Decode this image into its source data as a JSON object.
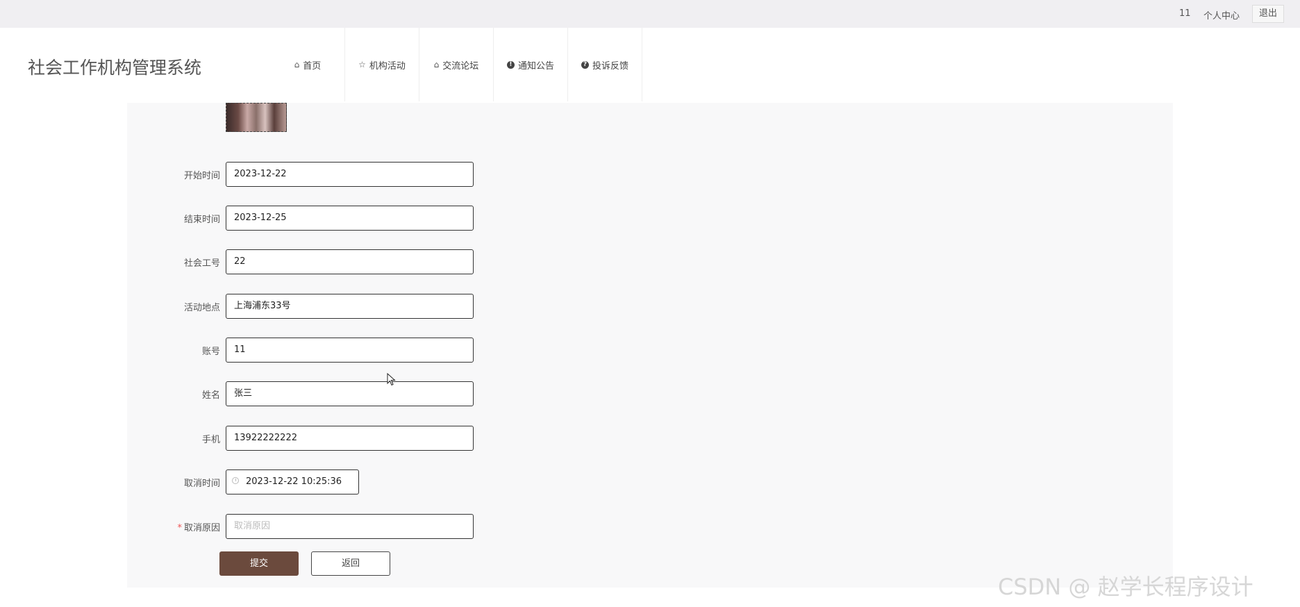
{
  "topbar": {
    "username": "11",
    "profile_label": "个人中心",
    "logout_label": "退出"
  },
  "header": {
    "brand": "社会工作机构管理系统",
    "nav": [
      {
        "label": "首页",
        "icon": "home-icon"
      },
      {
        "label": "机构活动",
        "icon": "star-icon"
      },
      {
        "label": "交流论坛",
        "icon": "bag-icon"
      },
      {
        "label": "通知公告",
        "icon": "alert-icon"
      },
      {
        "label": "投诉反馈",
        "icon": "question-icon"
      }
    ]
  },
  "form": {
    "fields": [
      {
        "label": "开始时间",
        "value": "2023-12-22"
      },
      {
        "label": "结束时间",
        "value": "2023-12-25"
      },
      {
        "label": "社会工号",
        "value": "22"
      },
      {
        "label": "活动地点",
        "value": "上海浦东33号"
      },
      {
        "label": "账号",
        "value": "11"
      },
      {
        "label": "姓名",
        "value": "张三"
      },
      {
        "label": "手机",
        "value": "13922222222"
      },
      {
        "label": "取消时间",
        "value": "2023-12-22 10:25:36"
      },
      {
        "label": "取消原因",
        "value": "",
        "placeholder": "取消原因",
        "required_mark": "*"
      }
    ],
    "submit_label": "提交",
    "back_label": "返回"
  },
  "watermark": "CSDN @ 赵学长程序设计"
}
